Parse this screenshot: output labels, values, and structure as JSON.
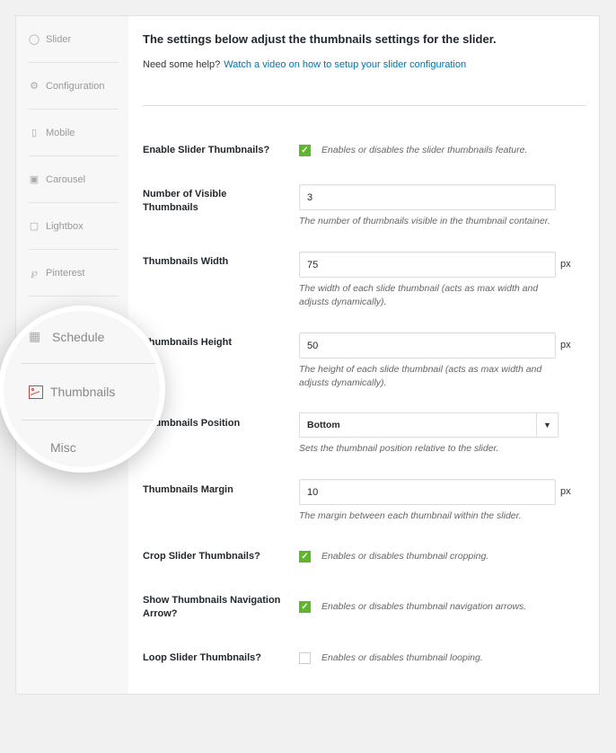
{
  "sidebar": {
    "items": [
      {
        "label": "Slider",
        "icon": "circle-icon"
      },
      {
        "label": "Configuration",
        "icon": "gear-icon"
      },
      {
        "label": "Mobile",
        "icon": "mobile-icon"
      },
      {
        "label": "Carousel",
        "icon": "carousel-icon"
      },
      {
        "label": "Lightbox",
        "icon": "lightbox-icon"
      },
      {
        "label": "Pinterest",
        "icon": "pinterest-icon"
      },
      {
        "label": "Schedule",
        "icon": "calendar-icon"
      },
      {
        "label": "Thumbnails",
        "icon": "image-icon",
        "active": true
      },
      {
        "label": "Misc",
        "icon": "misc-icon"
      }
    ],
    "active_color": "#dd3d36"
  },
  "main": {
    "heading": "The settings below adjust the thumbnails settings for the slider.",
    "help_prefix": "Need some help?",
    "help_link": "Watch a video on how to setup your slider configuration",
    "fields": {
      "enable": {
        "label": "Enable Slider Thumbnails?",
        "checked": true,
        "desc": "Enables or disables the slider thumbnails feature."
      },
      "visible": {
        "label": "Number of Visible Thumbnails",
        "value": "3",
        "desc": "The number of thumbnails visible in the thumbnail container."
      },
      "width": {
        "label": "Thumbnails Width",
        "value": "75",
        "unit": "px",
        "desc": "The width of each slide thumbnail (acts as max width and adjusts dynamically)."
      },
      "height": {
        "label": "Thumbnails Height",
        "value": "50",
        "unit": "px",
        "desc": "The height of each slide thumbnail (acts as max width and adjusts dynamically)."
      },
      "position": {
        "label": "Thumbnails Position",
        "value": "Bottom",
        "desc": "Sets the thumbnail position relative to the slider."
      },
      "margin": {
        "label": "Thumbnails Margin",
        "value": "10",
        "unit": "px",
        "desc": "The margin between each thumbnail within the slider."
      },
      "crop": {
        "label": "Crop Slider Thumbnails?",
        "checked": true,
        "desc": "Enables or disables thumbnail cropping."
      },
      "nav": {
        "label": "Show Thumbnails Navigation Arrow?",
        "checked": true,
        "desc": "Enables or disables thumbnail navigation arrows."
      },
      "loop": {
        "label": "Loop Slider Thumbnails?",
        "checked": false,
        "desc": "Enables or disables thumbnail looping."
      }
    },
    "check_color": "#5cb72b"
  }
}
